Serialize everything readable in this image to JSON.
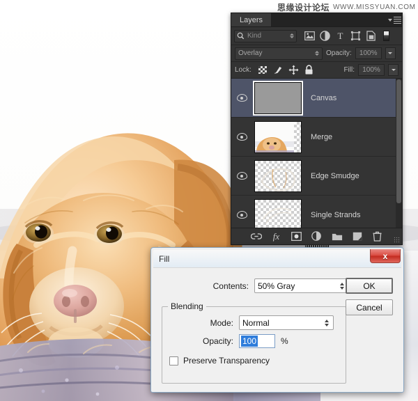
{
  "watermark": {
    "cn_text": "思缘设计论坛",
    "url_text": "WWW.MISSYUAN.COM"
  },
  "layers_panel": {
    "tab_label": "Layers",
    "menu_icon": "panel-menu-icon",
    "filter": {
      "search_icon": "search-icon",
      "kind_label": "Kind",
      "icons": [
        {
          "name": "filter-pixel-icon",
          "glyph": "image"
        },
        {
          "name": "filter-adjustment-icon",
          "glyph": "circle-half"
        },
        {
          "name": "filter-type-icon",
          "glyph": "T"
        },
        {
          "name": "filter-shape-icon",
          "glyph": "shape"
        },
        {
          "name": "filter-smart-object-icon",
          "glyph": "smart"
        },
        {
          "name": "filter-toggle-icon",
          "glyph": "swatch"
        }
      ]
    },
    "blend_mode": "Overlay",
    "opacity_label": "Opacity:",
    "opacity_value": "100%",
    "lock_label": "Lock:",
    "lock_icons": [
      {
        "name": "lock-transparent-pixels-icon"
      },
      {
        "name": "lock-image-pixels-icon"
      },
      {
        "name": "lock-position-icon"
      },
      {
        "name": "lock-all-icon"
      }
    ],
    "fill_label": "Fill:",
    "fill_value": "100%",
    "layers": [
      {
        "name": "Canvas",
        "selected": true,
        "thumb": "gray",
        "visible": true
      },
      {
        "name": "Merge",
        "selected": false,
        "thumb": "dog",
        "visible": true
      },
      {
        "name": "Edge Smudge",
        "selected": false,
        "thumb": "transparent",
        "visible": true
      },
      {
        "name": "Single Strands",
        "selected": false,
        "thumb": "transparent",
        "visible": true
      }
    ],
    "footer_icons": [
      {
        "name": "link-layers-icon"
      },
      {
        "name": "layer-style-fx-icon",
        "label": "fx"
      },
      {
        "name": "add-layer-mask-icon"
      },
      {
        "name": "new-adjustment-layer-icon"
      },
      {
        "name": "new-group-icon"
      },
      {
        "name": "new-layer-icon"
      },
      {
        "name": "delete-layer-icon"
      }
    ]
  },
  "fill_dialog": {
    "title": "Fill",
    "close_label": "x",
    "contents_label": "Contents:",
    "contents_value": "50% Gray",
    "ok_label": "OK",
    "cancel_label": "Cancel",
    "blending_legend": "Blending",
    "mode_label": "Mode:",
    "mode_value": "Normal",
    "opacity_label": "Opacity:",
    "opacity_value": "100",
    "percent_label": "%",
    "preserve_transparency_label": "Preserve Transparency",
    "preserve_transparency_checked": false
  },
  "colors": {
    "panel_bg": "#2e2e2e",
    "selected_layer": "#4e5468",
    "dialog_bg": "#f0f0f0",
    "close_red": "#d9493f",
    "selection_blue": "#2f7ddb"
  }
}
